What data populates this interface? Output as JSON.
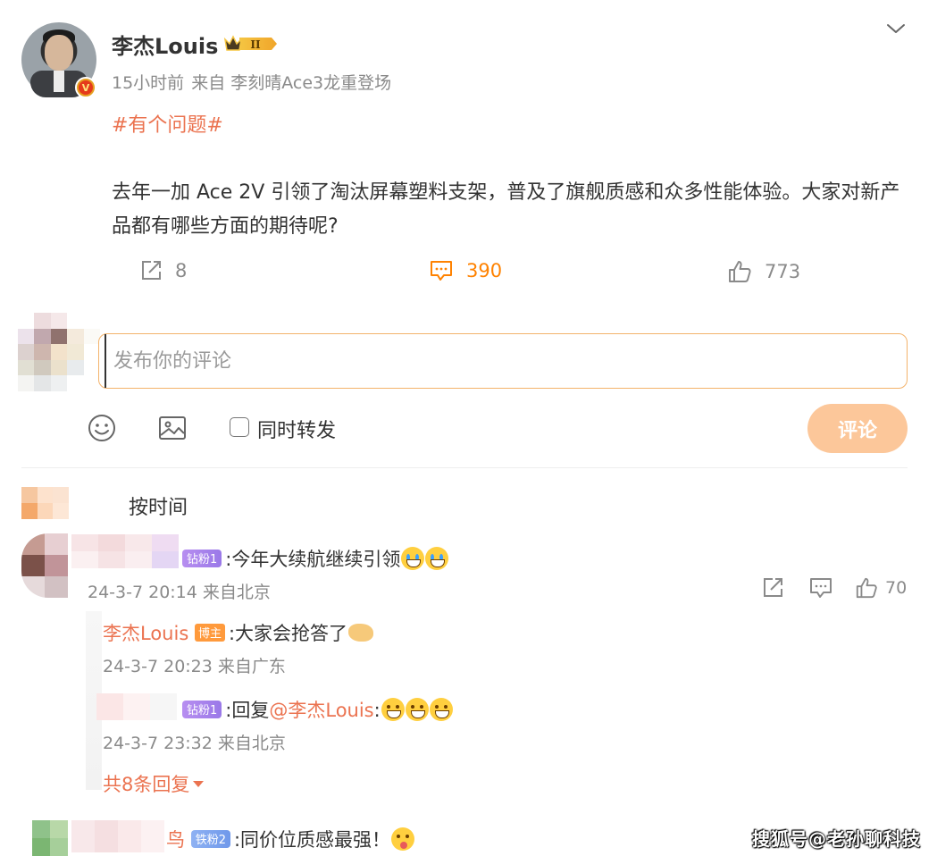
{
  "post": {
    "author": "李杰Louis",
    "level_badge": "II",
    "time": "15小时前",
    "source": "来自 李刻晴Ace3龙重登场",
    "topic": "#有个问题#",
    "body": "去年一加 Ace 2V 引领了淘汰屏幕塑料支架，普及了旗舰质感和众多性能体验。大家对新产品都有哪些方面的期待呢?",
    "repost_count": "8",
    "comment_count": "390",
    "like_count": "773",
    "verified_mark": "V"
  },
  "composer": {
    "placeholder": "发布你的评论",
    "repost_label": "同时转发",
    "submit_label": "评论"
  },
  "sort": {
    "label": "按时间"
  },
  "comments": [
    {
      "badge": "钻粉1",
      "text": ":今年大续航继续引领",
      "meta": "24-3-7 20:14 来自北京",
      "like_count": "70",
      "replies": [
        {
          "author": "李杰Louis",
          "badge": "博主",
          "text": ":大家会抢答了",
          "meta": "24-3-7 20:23 来自广东"
        },
        {
          "badge": "钻粉1",
          "prefix": ":回复",
          "mention": "@李杰Louis",
          "suffix": ":",
          "meta": "24-3-7 23:32 来自北京"
        }
      ],
      "more_replies": "共8条回复"
    },
    {
      "name_tail": "鸟",
      "badge": "铁粉2",
      "text": ":同价位质感最强！"
    }
  ],
  "watermark": "搜狐号@老孙聊科技",
  "colors": {
    "accent": "#eb7350",
    "comment_active": "#ff8200",
    "submit_disabled": "#fcc79a",
    "input_border": "#f3b36b"
  },
  "icons": [
    "chevron-down-icon",
    "share-icon",
    "comment-icon",
    "like-icon",
    "emoji-icon",
    "image-icon"
  ]
}
